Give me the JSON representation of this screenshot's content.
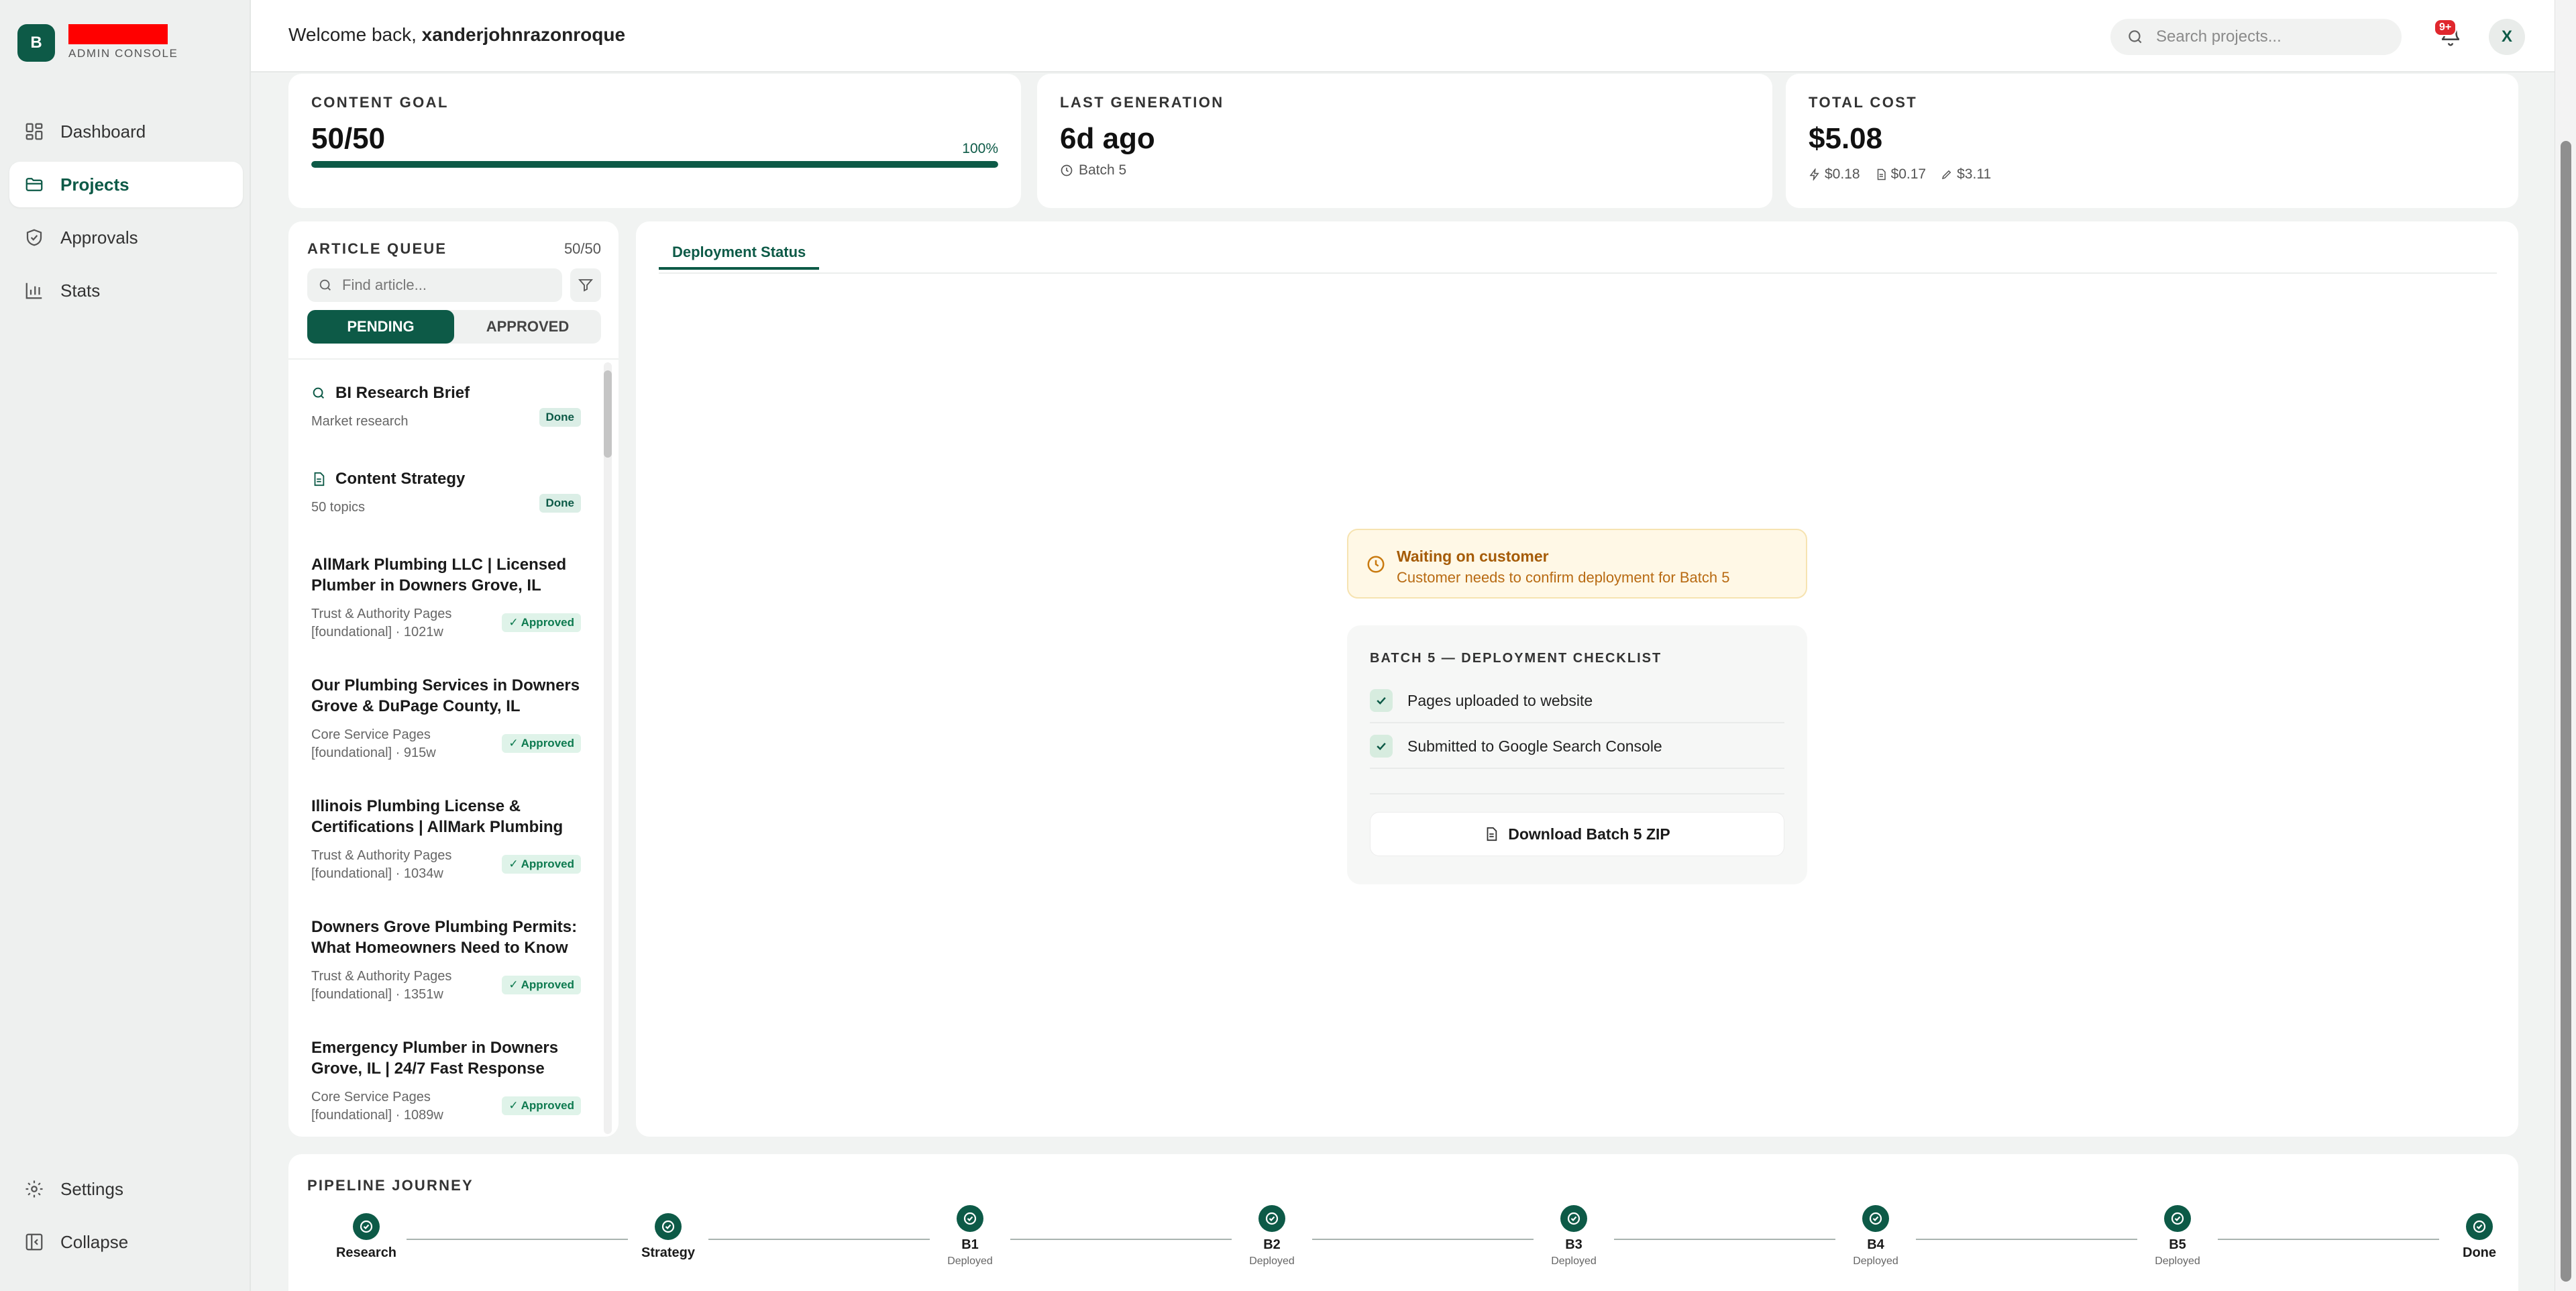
{
  "sidebar": {
    "brand_initial": "B",
    "brand_sub": "ADMIN CONSOLE",
    "items": [
      {
        "label": "Dashboard",
        "icon": "dashboard-icon"
      },
      {
        "label": "Projects",
        "icon": "folder-icon"
      },
      {
        "label": "Approvals",
        "icon": "shield-check-icon"
      },
      {
        "label": "Stats",
        "icon": "bar-chart-icon"
      }
    ],
    "bottom": [
      {
        "label": "Settings",
        "icon": "gear-icon"
      },
      {
        "label": "Collapse",
        "icon": "collapse-icon"
      }
    ]
  },
  "header": {
    "welcome_prefix": "Welcome back, ",
    "username": "xanderjohnrazonroque",
    "search_placeholder": "Search projects...",
    "notification_badge": "9+",
    "avatar_initial": "X"
  },
  "stats": {
    "content_goal": {
      "label": "CONTENT GOAL",
      "value": "50/50",
      "percent": "100%",
      "progress": 1.0
    },
    "last_generation": {
      "label": "LAST GENERATION",
      "value": "6d ago",
      "sub": "Batch 5"
    },
    "total_cost": {
      "label": "TOTAL COST",
      "value": "$5.08",
      "breakdown": [
        "$0.18",
        "$0.17",
        "$3.11"
      ]
    }
  },
  "queue": {
    "title": "ARTICLE QUEUE",
    "count": "50/50",
    "search_placeholder": "Find article...",
    "tabs": [
      "PENDING",
      "APPROVED"
    ],
    "items": [
      {
        "title": "BI Research Brief",
        "sub": "Market research",
        "badge": "Done",
        "icon": "search-icon"
      },
      {
        "title": "Content Strategy",
        "sub": "50 topics",
        "badge": "Done",
        "icon": "document-icon"
      },
      {
        "title": "AllMark Plumbing LLC | Licensed Plumber in Downers Grove, IL",
        "sub": "Trust & Authority Pages [foundational] · 1021w",
        "badge": "✓ Approved"
      },
      {
        "title": "Our Plumbing Services in Downers Grove & DuPage County, IL",
        "sub": "Core Service Pages [foundational] · 915w",
        "badge": "✓ Approved"
      },
      {
        "title": "Illinois Plumbing License & Certifications | AllMark Plumbing",
        "sub": "Trust & Authority Pages [foundational] · 1034w",
        "badge": "✓ Approved"
      },
      {
        "title": "Downers Grove Plumbing Permits: What Homeowners Need to Know",
        "sub": "Trust & Authority Pages [foundational] · 1351w",
        "badge": "✓ Approved"
      },
      {
        "title": "Emergency Plumber in Downers Grove, IL | 24/7 Fast Response",
        "sub": "Core Service Pages [foundational] · 1089w",
        "badge": "✓ Approved"
      }
    ]
  },
  "main": {
    "tab": "Deployment Status",
    "waiting_title": "Waiting on customer",
    "waiting_sub": "Customer needs to confirm deployment for Batch 5",
    "checklist_title": "BATCH 5 — DEPLOYMENT CHECKLIST",
    "checklist": [
      "Pages uploaded to website",
      "Submitted to Google Search Console"
    ],
    "download_label": "Download Batch 5 ZIP"
  },
  "pipeline": {
    "title": "PIPELINE JOURNEY",
    "stages": [
      {
        "label": "Research",
        "sub": ""
      },
      {
        "label": "Strategy",
        "sub": ""
      },
      {
        "label": "B1",
        "sub": "Deployed"
      },
      {
        "label": "B2",
        "sub": "Deployed"
      },
      {
        "label": "B3",
        "sub": "Deployed"
      },
      {
        "label": "B4",
        "sub": "Deployed"
      },
      {
        "label": "B5",
        "sub": "Deployed"
      },
      {
        "label": "Done",
        "sub": ""
      }
    ]
  },
  "colors": {
    "accent": "#0d5a47",
    "warning_bg": "#fff8e6",
    "warning_text": "#a55b07",
    "badge_red": "#e0272d"
  }
}
